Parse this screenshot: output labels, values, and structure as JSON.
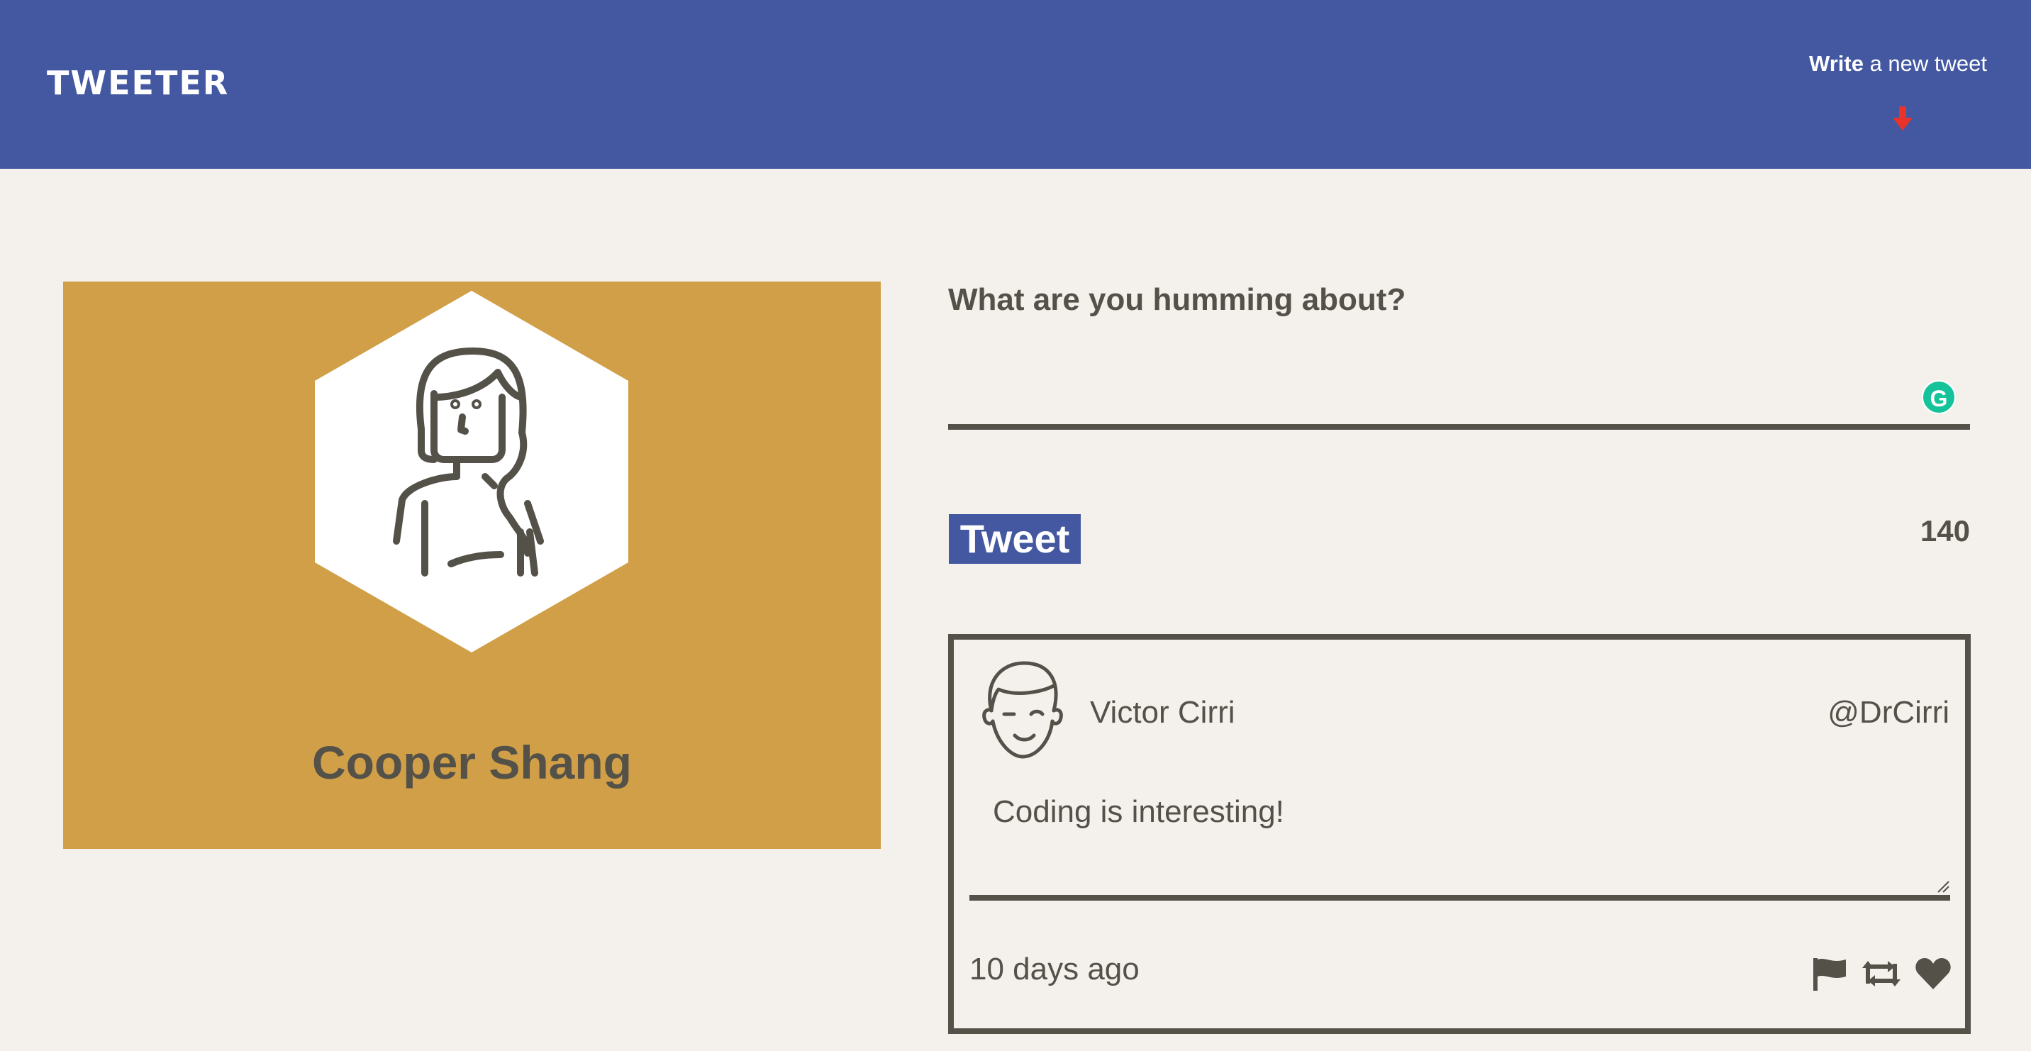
{
  "header": {
    "logo": "TWEETER",
    "compose_toggle_bold": "Write",
    "compose_toggle_rest": " a new tweet"
  },
  "profile": {
    "name": "Cooper Shang",
    "card_color": "#d09f47"
  },
  "compose": {
    "label": "What are you humming about?",
    "value": "",
    "tweet_button": "Tweet",
    "char_count": "140"
  },
  "tweet": {
    "author": "Victor Cirri",
    "handle": "@DrCirri",
    "text": "Coding is interesting!",
    "time": "10 days ago",
    "actions": [
      "flag-icon",
      "retweet-icon",
      "heart-icon"
    ]
  },
  "colors": {
    "navbar": "#4358a0",
    "background": "#f4f1ed",
    "text": "#545149",
    "accent_arrow": "#e8322a",
    "grammarly": "#15c39a"
  }
}
